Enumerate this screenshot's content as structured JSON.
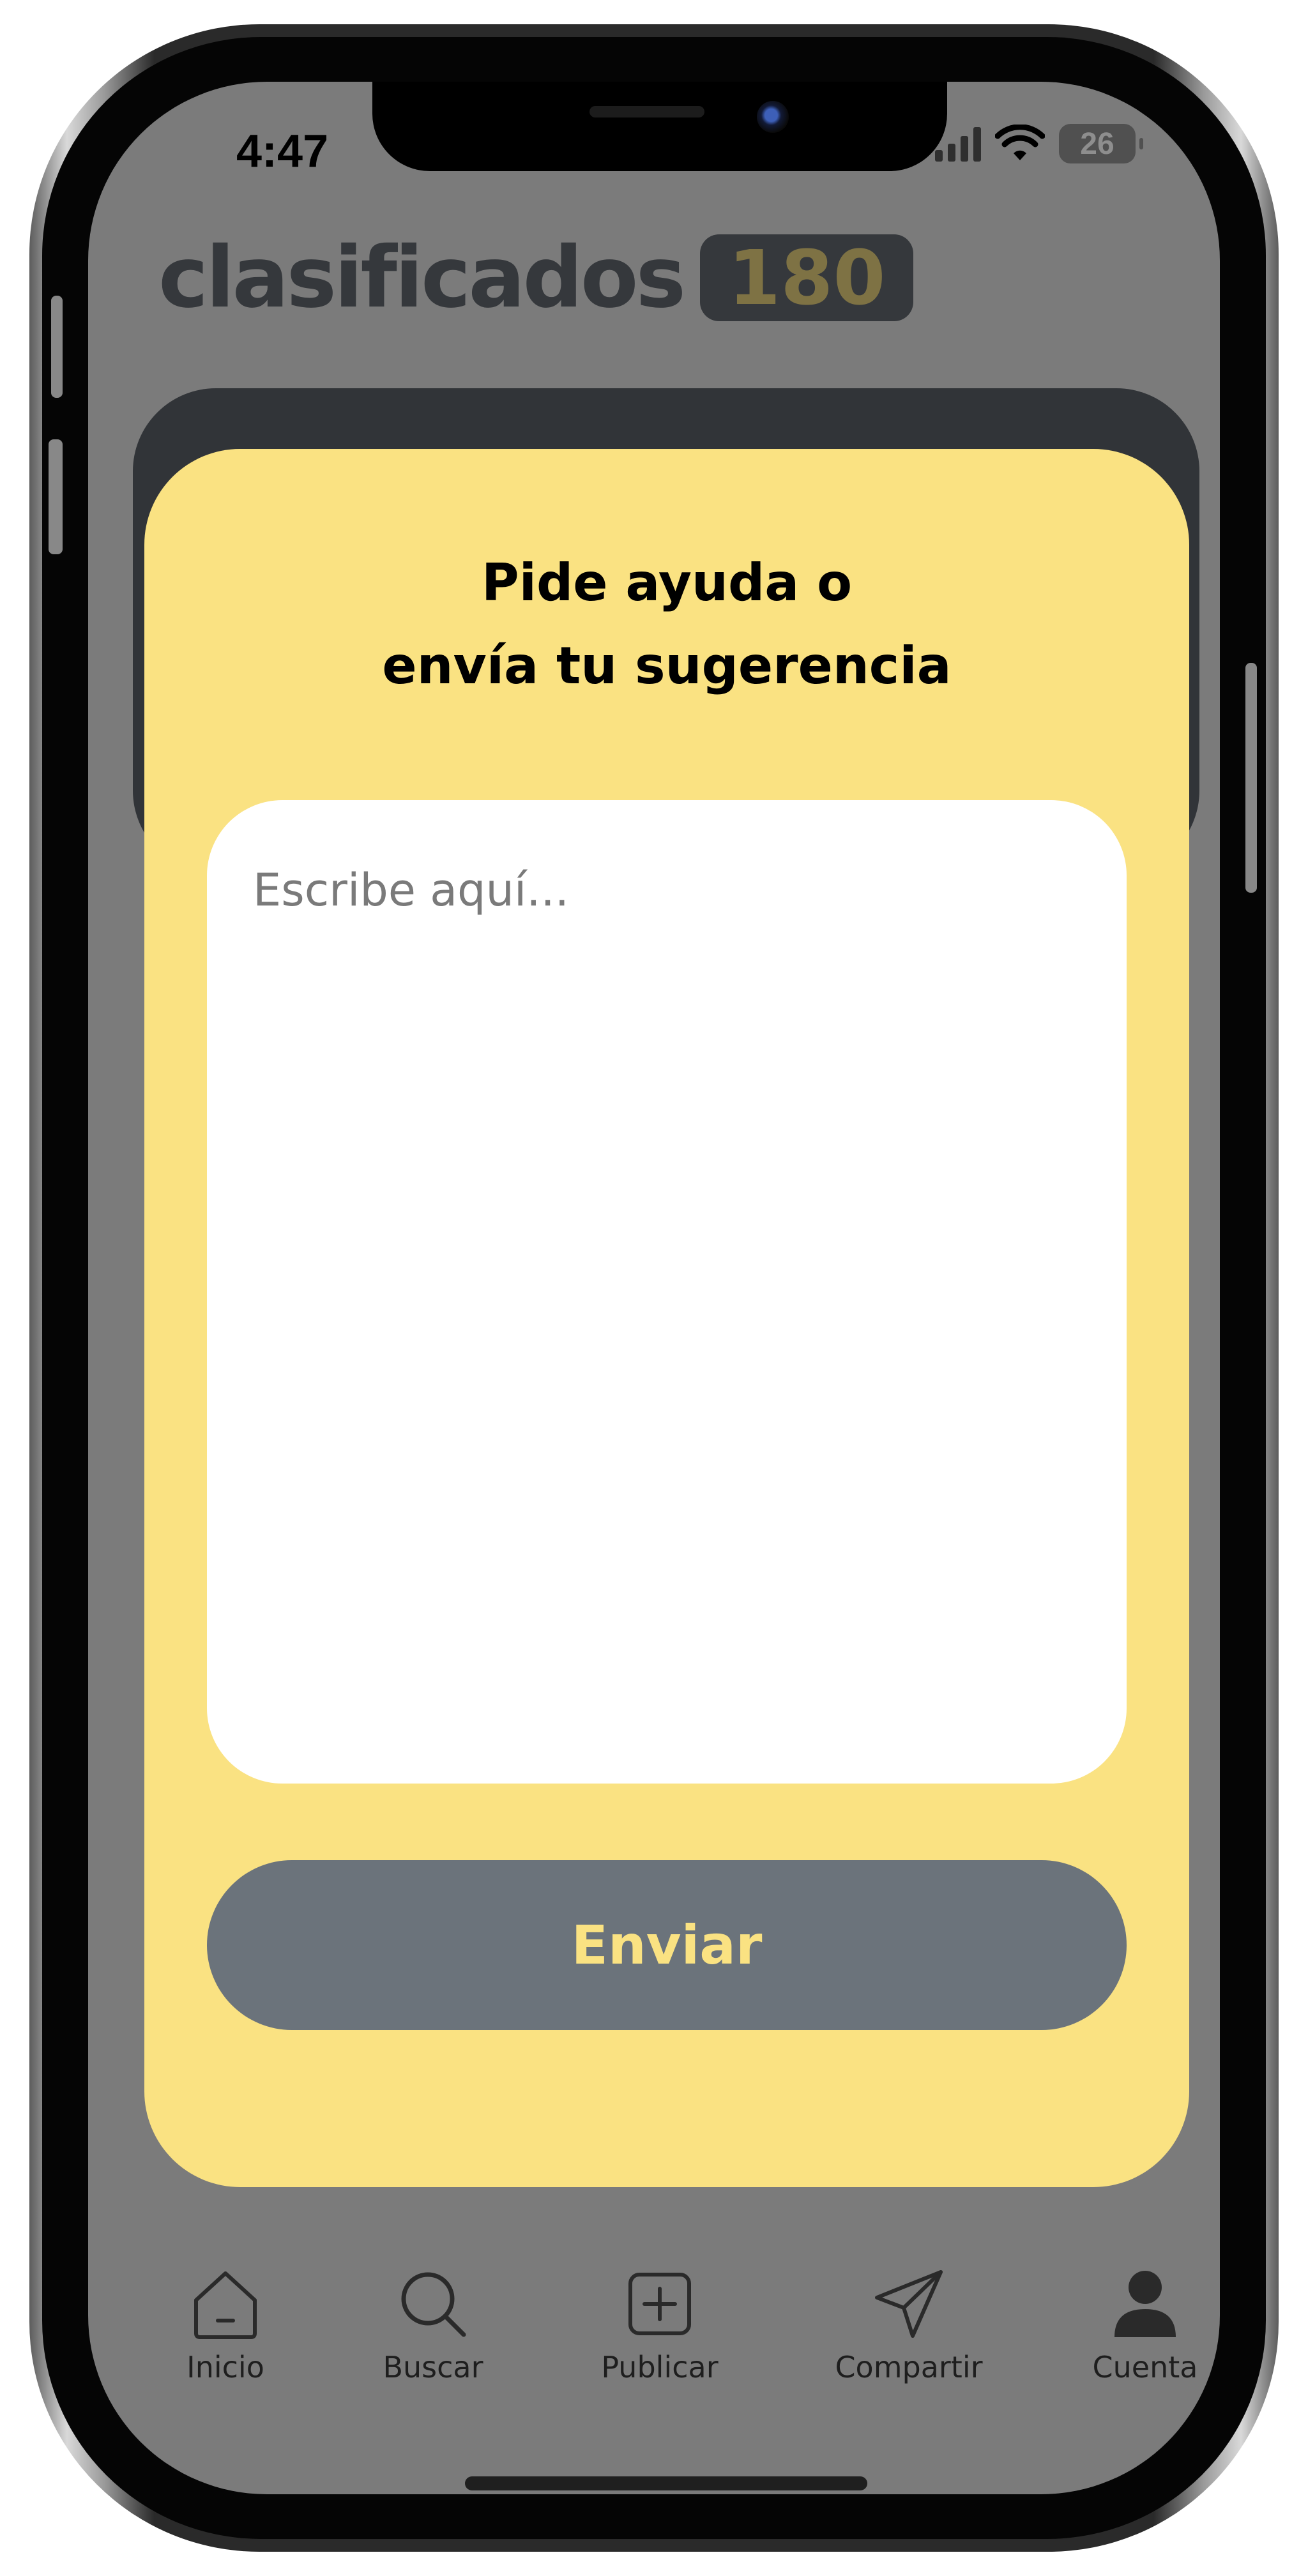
{
  "status_bar": {
    "time": "4:47",
    "battery": "26",
    "icons": [
      "signal-icon",
      "wifi-icon",
      "battery-icon"
    ]
  },
  "header": {
    "logo_word": "clasificados",
    "logo_badge": "180"
  },
  "modal": {
    "title": "Pide ayuda o\nenvía tu sugerencia",
    "message_placeholder": "Escribe aquí...",
    "message_value": "",
    "send_label": "Enviar"
  },
  "tabbar": {
    "items": [
      {
        "label": "Inicio",
        "icon": "home-icon"
      },
      {
        "label": "Buscar",
        "icon": "search-icon"
      },
      {
        "label": "Publicar",
        "icon": "add-square-icon"
      },
      {
        "label": "Compartir",
        "icon": "send-icon"
      },
      {
        "label": "Cuenta",
        "icon": "user-icon"
      }
    ]
  },
  "colors": {
    "modal_background": "#fae282",
    "button_background": "#6b737b",
    "button_text": "#fae282",
    "overlay": "#7b7b7b",
    "dark_card": "#313438"
  }
}
